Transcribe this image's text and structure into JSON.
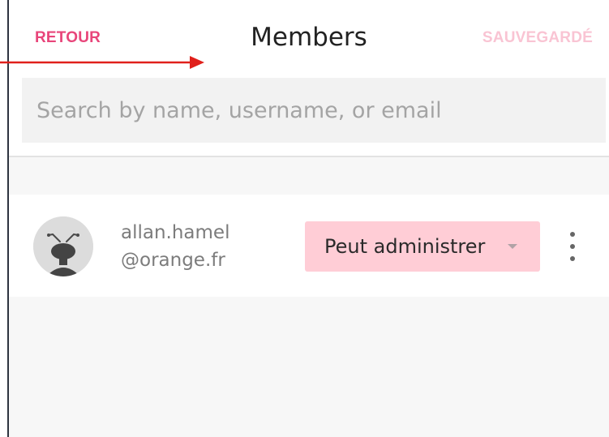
{
  "header": {
    "back_label": "RETOUR",
    "title": "Members",
    "save_label": "SAUVEGARDÉ"
  },
  "search": {
    "placeholder": "Search by name, username, or email"
  },
  "members": [
    {
      "name_line1": "allan.hamel",
      "name_line2": "@orange.fr",
      "role": "Peut administrer"
    }
  ],
  "icons": {
    "avatar": "ant-avatar-icon",
    "role_dropdown": "caret-down-icon",
    "menu": "more-vertical-icon",
    "annotation": "red-arrow-annotation"
  },
  "colors": {
    "accent": "#e8457a",
    "accent_disabled": "#f9c4d3",
    "role_badge": "#ffcdd6",
    "search_bg": "#f2f2f2",
    "annotation": "#e0201b"
  }
}
